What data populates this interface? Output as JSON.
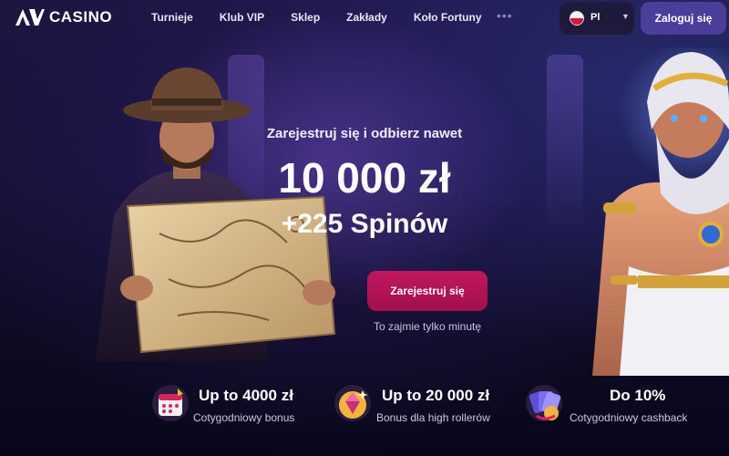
{
  "brand": {
    "logo_text": "CASINO"
  },
  "nav": {
    "links": [
      "Turnieje",
      "Klub VIP",
      "Sklep",
      "Zakłady",
      "Koło Fortuny"
    ],
    "more_label": "•••"
  },
  "language": {
    "code": "Pl"
  },
  "auth": {
    "login_label": "Zaloguj się"
  },
  "hero": {
    "subtitle": "Zarejestruj się i odbierz nawet",
    "amount": "10 000 zł",
    "spins": "+225 Spinów",
    "cta_label": "Zarejestruj się",
    "cta_note": "To zajmie tylko minutę"
  },
  "features": [
    {
      "title": "Up to 4000 zł",
      "desc": "Cotygodniowy bonus",
      "icon": "calendar-gift-icon"
    },
    {
      "title": "Up to 20 000 zł",
      "desc": "Bonus dla high rollerów",
      "icon": "diamond-icon"
    },
    {
      "title": "Do 10%",
      "desc": "Cotygodniowy cashback",
      "icon": "cards-icon"
    }
  ],
  "colors": {
    "accent": "#c2175f",
    "login_bg": "#4b3d9a",
    "nav_pill": "#1d1a3c"
  }
}
